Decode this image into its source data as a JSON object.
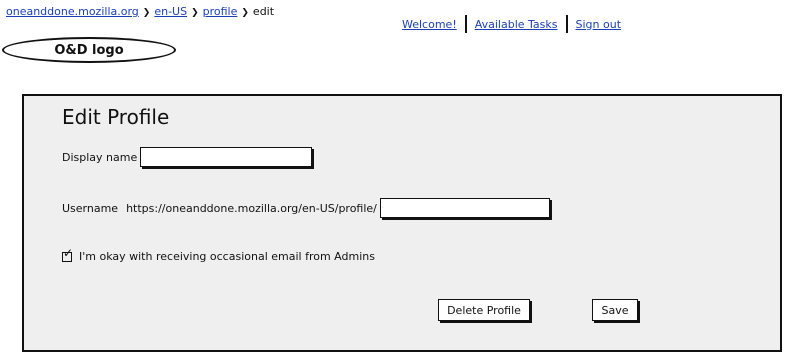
{
  "breadcrumb": {
    "items": [
      {
        "label": "oneanddone.mozilla.org",
        "link": true
      },
      {
        "label": "en-US",
        "link": true
      },
      {
        "label": "profile",
        "link": true
      },
      {
        "label": "edit",
        "link": false
      }
    ],
    "separator": "❯"
  },
  "topnav": {
    "welcome": "Welcome!",
    "available_tasks": "Available Tasks",
    "sign_out": "Sign out"
  },
  "logo": {
    "label": "O&D logo"
  },
  "panel": {
    "title": "Edit Profile",
    "display_name_label": "Display name",
    "display_name_value": "",
    "username_label": "Username",
    "username_prefix": "https://oneanddone.mozilla.org/en-US/profile/",
    "username_value": "",
    "email_optin_label": "I'm okay with receiving occasional email from Admins",
    "email_optin_checked": true,
    "check_glyph": "✓",
    "delete_button": "Delete Profile",
    "save_button": "Save"
  },
  "colors": {
    "link": "#1a3fb5",
    "panel_bg": "#efefef",
    "border": "#111111"
  }
}
